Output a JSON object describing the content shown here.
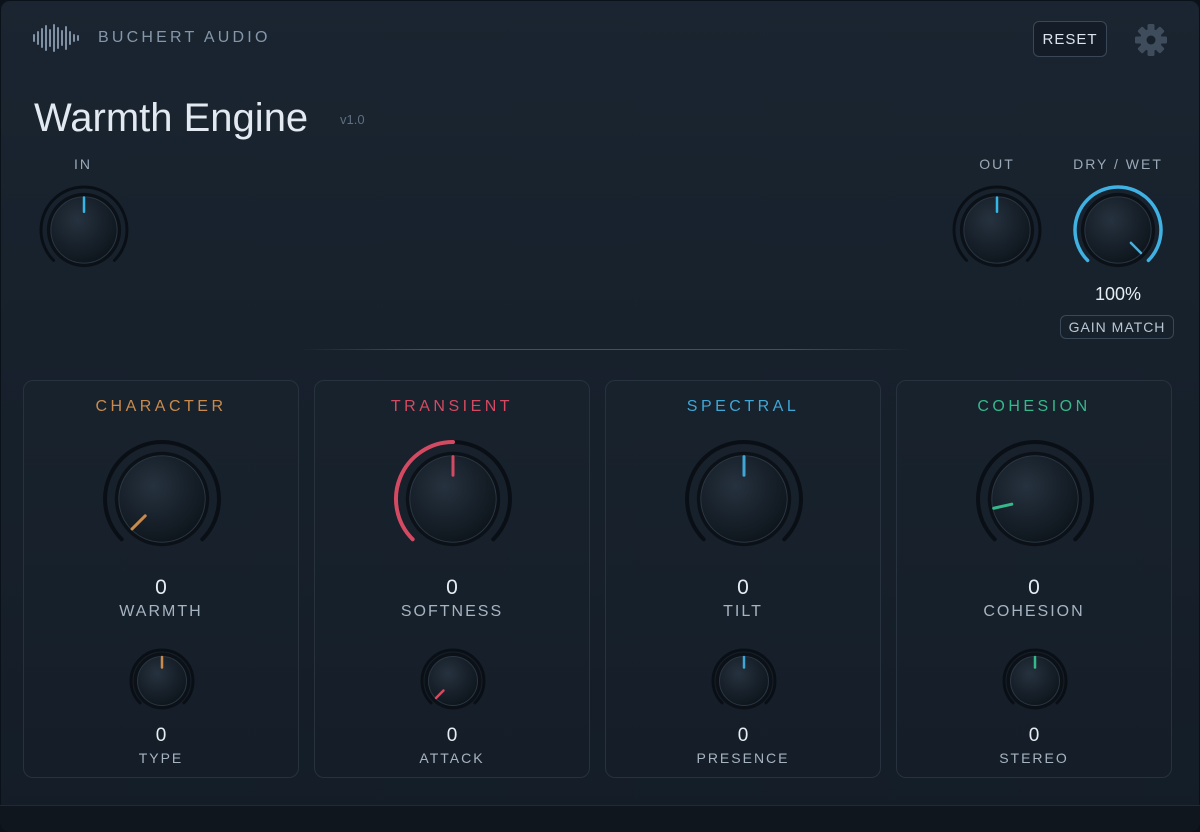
{
  "header": {
    "brand": "BUCHERT AUDIO",
    "reset_label": "RESET",
    "settings_icon": "gear-icon"
  },
  "plugin": {
    "title": "Warmth Engine",
    "version": "v1.0"
  },
  "io": {
    "in": {
      "label": "IN",
      "value_fraction": 0.5,
      "color": "#35b6e8"
    },
    "out": {
      "label": "OUT",
      "value_fraction": 0.5,
      "color": "#35b6e8"
    },
    "drywet": {
      "label": "DRY / WET",
      "value": "100%",
      "value_fraction": 1.0,
      "color": "#3fb2e3"
    },
    "gain_match_label": "GAIN MATCH"
  },
  "panels": [
    {
      "title": "CHARACTER",
      "color": "#c98a4b",
      "main": {
        "label": "WARMTH",
        "value": "0",
        "value_fraction": 0.0,
        "arc": false
      },
      "sub": {
        "label": "TYPE",
        "value": "0",
        "value_fraction": 0.5
      }
    },
    {
      "title": "TRANSIENT",
      "color": "#d44a62",
      "main": {
        "label": "SOFTNESS",
        "value": "0",
        "value_fraction": 0.5,
        "arc": true
      },
      "sub": {
        "label": "ATTACK",
        "value": "0",
        "value_fraction": 0.0
      }
    },
    {
      "title": "SPECTRAL",
      "color": "#3fa6d6",
      "main": {
        "label": "TILT",
        "value": "0",
        "value_fraction": 0.5,
        "arc": false
      },
      "sub": {
        "label": "PRESENCE",
        "value": "0",
        "value_fraction": 0.5
      }
    },
    {
      "title": "COHESION",
      "color": "#35b88a",
      "main": {
        "label": "COHESION",
        "value": "0",
        "value_fraction": 0.12,
        "arc": false
      },
      "sub": {
        "label": "STEREO",
        "value": "0",
        "value_fraction": 0.5
      }
    }
  ]
}
